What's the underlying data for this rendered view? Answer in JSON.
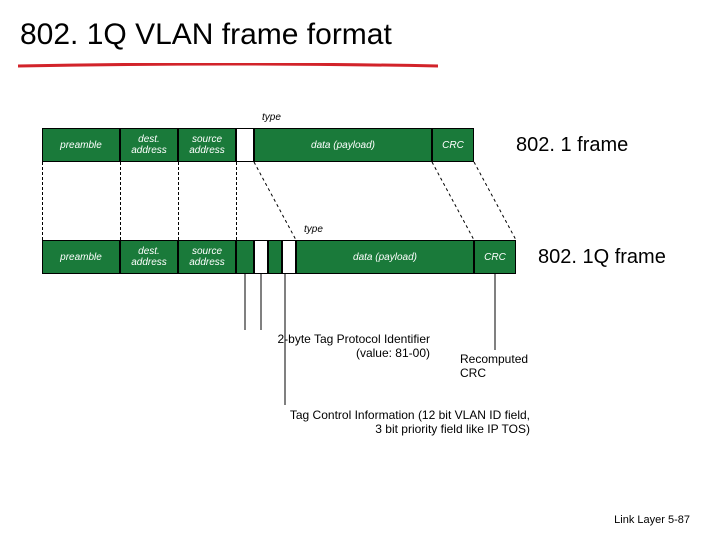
{
  "title": "802. 1Q VLAN frame format",
  "labels": {
    "type1": "type",
    "type2": "type",
    "frame1": "802. 1 frame",
    "frame2": "802. 1Q frame"
  },
  "frame1": {
    "preamble": "preamble",
    "dest": "dest.\naddress",
    "source": "source\naddress",
    "typegap": "",
    "data": "data (payload)",
    "crc": "CRC"
  },
  "frame2": {
    "preamble": "preamble",
    "dest": "dest.\naddress",
    "source": "source\naddress",
    "tpid": "",
    "tci": "",
    "typegap": "",
    "data": "data (payload)",
    "crc": "CRC"
  },
  "notes": {
    "tpid": "2-byte Tag Protocol Identifier\n(value: 81-00)",
    "crc": "Recomputed\nCRC",
    "tci": "Tag Control Information (12 bit VLAN ID field,\n3 bit priority field like IP TOS)"
  },
  "footer": "Link Layer  5-87"
}
